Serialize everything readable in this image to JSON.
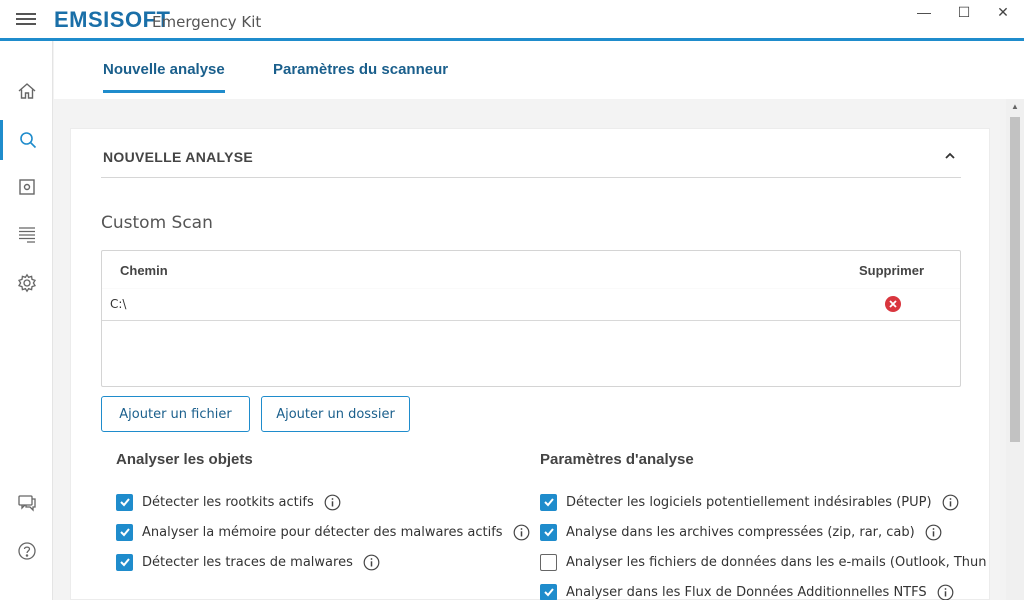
{
  "app": {
    "brand": "EMSISOFT",
    "subtitle": "Emergency Kit"
  },
  "window_controls": {
    "minimize": "—",
    "maximize": "☐",
    "close": "✕"
  },
  "sidebar": {
    "items": [
      {
        "name": "home",
        "icon": "home-icon",
        "active": false
      },
      {
        "name": "scan",
        "icon": "search-icon",
        "active": true
      },
      {
        "name": "quarantine",
        "icon": "quarantine-icon",
        "active": false
      },
      {
        "name": "logs",
        "icon": "logs-icon",
        "active": false
      },
      {
        "name": "settings",
        "icon": "gear-icon",
        "active": false
      },
      {
        "name": "support",
        "icon": "chat-icon",
        "active": false
      },
      {
        "name": "help",
        "icon": "help-icon",
        "active": false
      }
    ]
  },
  "tabs": [
    {
      "label": "Nouvelle analyse",
      "active": true
    },
    {
      "label": "Paramètres du scanneur",
      "active": false
    }
  ],
  "card": {
    "title": "NOUVELLE ANALYSE",
    "scan_name": "Custom Scan",
    "table": {
      "col_path": "Chemin",
      "col_delete": "Supprimer",
      "rows": [
        {
          "path": "C:\\"
        }
      ]
    },
    "add_file": "Ajouter un fichier",
    "add_folder": "Ajouter un dossier",
    "objects": {
      "title": "Analyser les objets",
      "options": [
        {
          "label": "Détecter les rootkits actifs",
          "checked": true
        },
        {
          "label": "Analyser la mémoire pour détecter des malwares actifs",
          "checked": true
        },
        {
          "label": "Détecter les traces de malwares",
          "checked": true
        }
      ]
    },
    "params": {
      "title": "Paramètres d'analyse",
      "options": [
        {
          "label": "Détecter les logiciels potentiellement indésirables (PUP)",
          "checked": true
        },
        {
          "label": "Analyse dans les archives compressées (zip, rar, cab)",
          "checked": true
        },
        {
          "label": "Analyser les fichiers de données dans les e-mails (Outlook, Thun",
          "checked": false
        },
        {
          "label": "Analyser dans les Flux de Données Additionnelles NTFS",
          "checked": true
        }
      ]
    }
  },
  "colors": {
    "accent": "#1f8ccc",
    "tab_text": "#1a5f8c",
    "delete_red": "#d9363e"
  }
}
